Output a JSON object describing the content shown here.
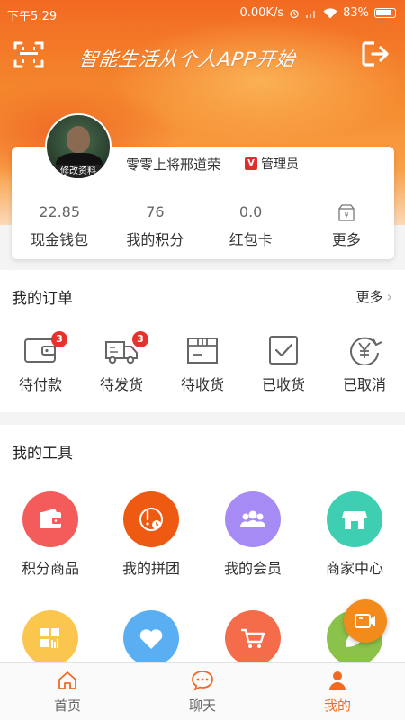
{
  "status_bar": {
    "time": "下午5:29",
    "net_speed": "0.00K/s",
    "battery": "83%"
  },
  "header": {
    "slogan": "智能生活从个人APP开始"
  },
  "profile": {
    "edit_label": "修改资料",
    "name": "零零上将邢道荣",
    "role": "管理员",
    "role_badge": "V",
    "stats": [
      {
        "value": "22.85",
        "label": "现金钱包"
      },
      {
        "value": "76",
        "label": "我的积分"
      },
      {
        "value": "0.0",
        "label": "红包卡"
      },
      {
        "value": "",
        "label": "更多"
      }
    ]
  },
  "orders": {
    "title": "我的订单",
    "more": "更多",
    "items": [
      {
        "label": "待付款",
        "badge": "3",
        "icon": "wallet-icon"
      },
      {
        "label": "待发货",
        "badge": "3",
        "icon": "truck-icon"
      },
      {
        "label": "待收货",
        "badge": "",
        "icon": "package-icon"
      },
      {
        "label": "已收货",
        "badge": "",
        "icon": "checkbox-icon"
      },
      {
        "label": "已取消",
        "badge": "",
        "icon": "yen-refund-icon"
      }
    ]
  },
  "tools": {
    "title": "我的工具",
    "items": [
      {
        "label": "积分商品",
        "icon": "wallet-icon",
        "color": "#f45b5b"
      },
      {
        "label": "我的拼团",
        "icon": "group-buy-icon",
        "color": "#ee5a12"
      },
      {
        "label": "我的会员",
        "icon": "members-icon",
        "color": "#a78bf5"
      },
      {
        "label": "商家中心",
        "icon": "store-icon",
        "color": "#3ecfb2"
      },
      {
        "label": "",
        "icon": "grid-icon",
        "color": "#fbc64e"
      },
      {
        "label": "",
        "icon": "heart-icon",
        "color": "#5aaef2"
      },
      {
        "label": "",
        "icon": "cart-icon",
        "color": "#f56c4a"
      },
      {
        "label": "",
        "icon": "leaf-icon",
        "color": "#8bc34a"
      }
    ]
  },
  "floating_button": {
    "icon": "video-camera-icon",
    "color": "#f38a1c"
  },
  "tabbar": {
    "tabs": [
      {
        "label": "首页",
        "icon": "home-icon",
        "active": false
      },
      {
        "label": "聊天",
        "icon": "chat-icon",
        "active": false
      },
      {
        "label": "我的",
        "icon": "person-icon",
        "active": true
      }
    ]
  },
  "colors": {
    "brand": "#f26a22",
    "badge": "#e8302c",
    "text": "#333333"
  }
}
